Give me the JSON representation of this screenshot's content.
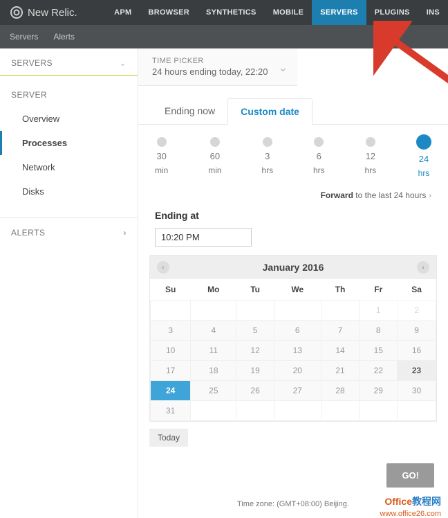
{
  "brand": "New Relic.",
  "topnav": [
    "APM",
    "BROWSER",
    "SYNTHETICS",
    "MOBILE",
    "SERVERS",
    "PLUGINS",
    "INS"
  ],
  "topnav_active": 4,
  "subnav": [
    "Servers",
    "Alerts"
  ],
  "sidebar": {
    "header": "SERVERS",
    "section": "SERVER",
    "items": [
      "Overview",
      "Processes",
      "Network",
      "Disks"
    ],
    "selected_index": 1,
    "alerts": "ALERTS"
  },
  "time_picker": {
    "label": "TIME PICKER",
    "value": "24 hours ending today, 22:20"
  },
  "tabs": {
    "ending_now": "Ending now",
    "custom_date": "Custom date"
  },
  "ranges": [
    {
      "num": "30",
      "unit": "min"
    },
    {
      "num": "60",
      "unit": "min"
    },
    {
      "num": "3",
      "unit": "hrs"
    },
    {
      "num": "6",
      "unit": "hrs"
    },
    {
      "num": "12",
      "unit": "hrs"
    },
    {
      "num": "24",
      "unit": "hrs"
    }
  ],
  "range_selected_index": 5,
  "forward": {
    "bold": "Forward",
    "rest": " to the last 24 hours"
  },
  "ending_at": {
    "label": "Ending at",
    "value": "10:20 PM"
  },
  "calendar": {
    "title": "January 2016",
    "weekdays": [
      "Su",
      "Mo",
      "Tu",
      "We",
      "Th",
      "Fr",
      "Sa"
    ],
    "rows": [
      [
        {
          "n": "",
          "c": "out"
        },
        {
          "n": "",
          "c": "out"
        },
        {
          "n": "",
          "c": "out"
        },
        {
          "n": "",
          "c": "out"
        },
        {
          "n": "",
          "c": "out"
        },
        {
          "n": "1",
          "c": "oth"
        },
        {
          "n": "2",
          "c": "oth"
        }
      ],
      [
        {
          "n": "3",
          "c": "in"
        },
        {
          "n": "4",
          "c": "in"
        },
        {
          "n": "5",
          "c": "in"
        },
        {
          "n": "6",
          "c": "in"
        },
        {
          "n": "7",
          "c": "in"
        },
        {
          "n": "8",
          "c": "in"
        },
        {
          "n": "9",
          "c": "in"
        }
      ],
      [
        {
          "n": "10",
          "c": "in"
        },
        {
          "n": "11",
          "c": "in"
        },
        {
          "n": "12",
          "c": "in"
        },
        {
          "n": "13",
          "c": "in"
        },
        {
          "n": "14",
          "c": "in"
        },
        {
          "n": "15",
          "c": "in"
        },
        {
          "n": "16",
          "c": "in"
        }
      ],
      [
        {
          "n": "17",
          "c": "in"
        },
        {
          "n": "18",
          "c": "in"
        },
        {
          "n": "19",
          "c": "in"
        },
        {
          "n": "20",
          "c": "in"
        },
        {
          "n": "21",
          "c": "in"
        },
        {
          "n": "22",
          "c": "in"
        },
        {
          "n": "23",
          "c": "hl"
        }
      ],
      [
        {
          "n": "24",
          "c": "sel"
        },
        {
          "n": "25",
          "c": "in"
        },
        {
          "n": "26",
          "c": "in"
        },
        {
          "n": "27",
          "c": "in"
        },
        {
          "n": "28",
          "c": "in"
        },
        {
          "n": "29",
          "c": "in"
        },
        {
          "n": "30",
          "c": "in"
        }
      ],
      [
        {
          "n": "31",
          "c": "in"
        },
        {
          "n": "",
          "c": "out"
        },
        {
          "n": "",
          "c": "out"
        },
        {
          "n": "",
          "c": "out"
        },
        {
          "n": "",
          "c": "out"
        },
        {
          "n": "",
          "c": "out"
        },
        {
          "n": "",
          "c": "out"
        }
      ]
    ],
    "today": "Today"
  },
  "go_label": "GO!",
  "timezone": "Time zone: (GMT+08:00) Beijing.",
  "watermark": {
    "line1a": "Office",
    "line1b": "教程网",
    "line2": "www.office26.com"
  }
}
